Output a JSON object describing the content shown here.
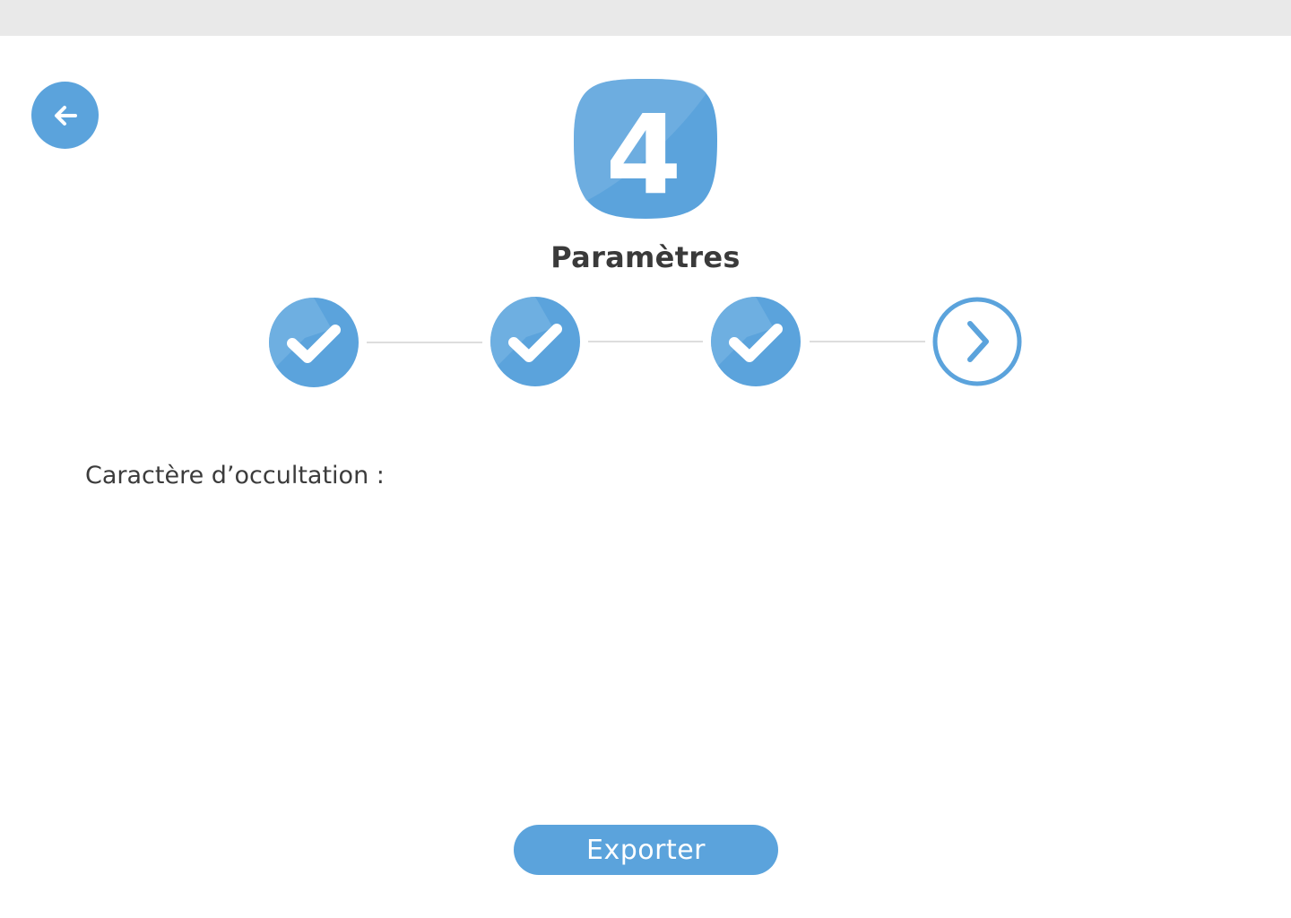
{
  "colors": {
    "accent": "#5ba3dc",
    "accent_light": "#7bb7e4",
    "topbar": "#e9e9e9",
    "text": "#3a3a3a",
    "connector": "#dddddd"
  },
  "header": {
    "back_icon": "arrow-left-icon",
    "step_number": "4",
    "step_title": "Paramètres"
  },
  "stepper": {
    "steps": [
      {
        "status": "completed",
        "icon": "checkmark-icon"
      },
      {
        "status": "completed",
        "icon": "checkmark-icon"
      },
      {
        "status": "completed",
        "icon": "checkmark-icon"
      },
      {
        "status": "current",
        "icon": "chevron-right-icon"
      }
    ]
  },
  "form": {
    "occultation_label": "Caractère d’occultation :"
  },
  "actions": {
    "export_label": "Exporter"
  }
}
